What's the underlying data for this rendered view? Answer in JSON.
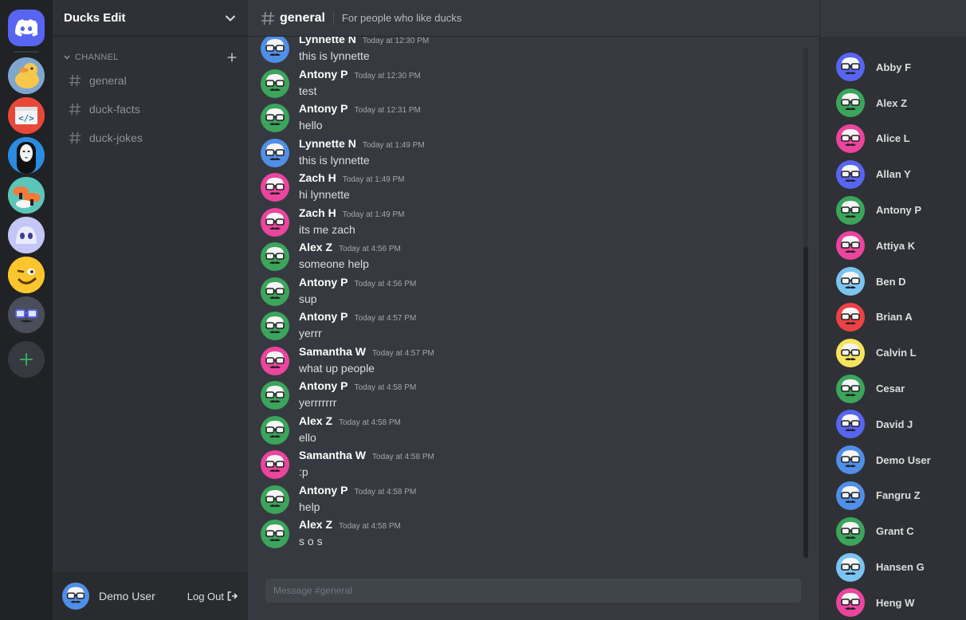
{
  "colors": {
    "blurple": "#5865f2",
    "green": "#3ba55c",
    "pink": "#eb459e",
    "blue": "#4f8fe8",
    "lightblue": "#7cc4f0",
    "red": "#ed4245",
    "yellow": "#f8e45c"
  },
  "servers": [
    {
      "name": "home",
      "icon": "discord-logo-icon"
    },
    {
      "name": "ducks-server",
      "icon": "duck-icon"
    },
    {
      "name": "code-server",
      "icon": "code-icon"
    },
    {
      "name": "noface-server",
      "icon": "no-face-icon"
    },
    {
      "name": "sushi-server",
      "icon": "sushi-icon"
    },
    {
      "name": "ghost-server",
      "icon": "ghost-icon"
    },
    {
      "name": "emoji-server",
      "icon": "wink-emoji-icon"
    },
    {
      "name": "glasses-server",
      "icon": "glasses-icon"
    }
  ],
  "guild": {
    "name": "Ducks Edit",
    "category": "CHANNEL",
    "channels": [
      {
        "label": "general"
      },
      {
        "label": "duck-facts"
      },
      {
        "label": "duck-jokes"
      }
    ]
  },
  "current_user": {
    "name": "Demo User",
    "logout_label": "Log Out"
  },
  "channel_header": {
    "name": "general",
    "topic": "For people who like ducks"
  },
  "composer": {
    "placeholder": "Message #general"
  },
  "messages": [
    {
      "author": "Lynnette N",
      "time": "Today at 12:30 PM",
      "text": "this is lynnette",
      "color": "blue"
    },
    {
      "author": "Antony P",
      "time": "Today at 12:30 PM",
      "text": "test",
      "color": "green"
    },
    {
      "author": "Antony P",
      "time": "Today at 12:31 PM",
      "text": "hello",
      "color": "green"
    },
    {
      "author": "Lynnette N",
      "time": "Today at 1:49 PM",
      "text": "this is lynnette",
      "color": "blue"
    },
    {
      "author": "Zach H",
      "time": "Today at 1:49 PM",
      "text": "hi lynnette",
      "color": "pink"
    },
    {
      "author": "Zach H",
      "time": "Today at 1:49 PM",
      "text": "its me zach",
      "color": "pink"
    },
    {
      "author": "Alex Z",
      "time": "Today at 4:56 PM",
      "text": "someone help",
      "color": "green"
    },
    {
      "author": "Antony P",
      "time": "Today at 4:56 PM",
      "text": "sup",
      "color": "green"
    },
    {
      "author": "Antony P",
      "time": "Today at 4:57 PM",
      "text": "yerrr",
      "color": "green"
    },
    {
      "author": "Samantha W",
      "time": "Today at 4:57 PM",
      "text": "what up people",
      "color": "pink"
    },
    {
      "author": "Antony P",
      "time": "Today at 4:58 PM",
      "text": "yerrrrrrr",
      "color": "green"
    },
    {
      "author": "Alex Z",
      "time": "Today at 4:58 PM",
      "text": "ello",
      "color": "green"
    },
    {
      "author": "Samantha W",
      "time": "Today at 4:58 PM",
      "text": ":p",
      "color": "pink"
    },
    {
      "author": "Antony P",
      "time": "Today at 4:58 PM",
      "text": "help",
      "color": "green"
    },
    {
      "author": "Alex Z",
      "time": "Today at 4:58 PM",
      "text": "s o s",
      "color": "green"
    }
  ],
  "members": [
    {
      "name": "Abby F",
      "color": "blurple"
    },
    {
      "name": "Alex Z",
      "color": "green"
    },
    {
      "name": "Alice L",
      "color": "pink"
    },
    {
      "name": "Allan Y",
      "color": "blurple"
    },
    {
      "name": "Antony P",
      "color": "green"
    },
    {
      "name": "Attiya K",
      "color": "pink"
    },
    {
      "name": "Ben D",
      "color": "lightblue"
    },
    {
      "name": "Brian A",
      "color": "red"
    },
    {
      "name": "Calvin L",
      "color": "yellow"
    },
    {
      "name": "Cesar",
      "color": "green"
    },
    {
      "name": "David J",
      "color": "blurple"
    },
    {
      "name": "Demo User",
      "color": "blue"
    },
    {
      "name": "Fangru Z",
      "color": "blue"
    },
    {
      "name": "Grant C",
      "color": "green"
    },
    {
      "name": "Hansen G",
      "color": "lightblue"
    },
    {
      "name": "Heng W",
      "color": "pink"
    }
  ]
}
